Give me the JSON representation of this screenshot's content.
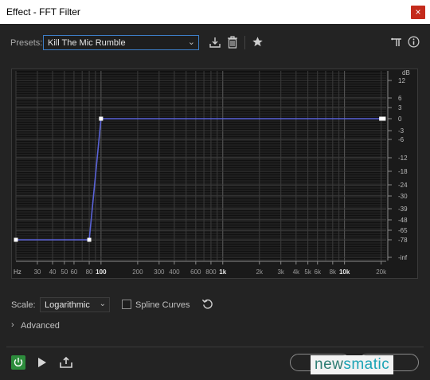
{
  "window": {
    "title": "Effect - FFT Filter",
    "close_glyph": "×"
  },
  "presets": {
    "label": "Presets:",
    "value": "Kill The Mic Rumble"
  },
  "toolbar": {
    "icons": [
      "download-preset-icon",
      "trash-icon",
      "star-icon",
      "routing-icon",
      "info-icon"
    ]
  },
  "graph": {
    "x_axis_unit": "Hz",
    "x_ticks": [
      "30",
      "40",
      "50",
      "60",
      "80",
      "100",
      "200",
      "300",
      "400",
      "600",
      "800",
      "1k",
      "2k",
      "3k",
      "4k",
      "5k",
      "6k",
      "8k",
      "10k",
      "20k"
    ],
    "y_axis_unit": "dB",
    "y_ticks": [
      "12",
      "6",
      "3",
      "0",
      "-3",
      "-6",
      "-12",
      "-18",
      "-24",
      "-30",
      "-39",
      "-48",
      "-65",
      "-78",
      "-inf"
    ]
  },
  "chart_data": {
    "type": "line",
    "x_scale": "log",
    "xlabel": "Hz",
    "ylabel": "dB",
    "series": [
      {
        "points": [
          [
            20,
            -78
          ],
          [
            80,
            -78
          ],
          [
            100,
            0
          ],
          [
            20000,
            0
          ],
          [
            21000,
            0
          ]
        ]
      }
    ],
    "grid": true
  },
  "scale": {
    "label": "Scale:",
    "value": "Logarithmic"
  },
  "spline": {
    "label": "Spline Curves",
    "checked": false
  },
  "advanced": {
    "label": "Advanced"
  },
  "watermark": {
    "text_a": "new",
    "text_b": "smatic"
  },
  "colors": {
    "curve": "#5a63d8",
    "power_on": "#2d8c3c",
    "focus": "#3d7ec7"
  }
}
